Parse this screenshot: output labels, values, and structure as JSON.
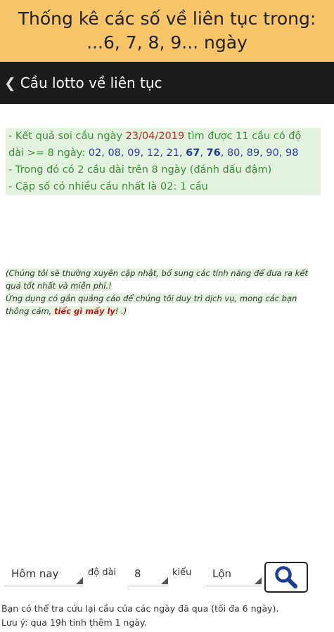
{
  "banner": {
    "line1": "Thống kê các số về liên tục trong:",
    "line2": "...6, 7, 8, 9... ngày"
  },
  "appbar": {
    "title": "Cầu lotto về liên tục"
  },
  "result": {
    "prefix": "- Kết quả soi cầu ngày ",
    "date": "23/04/2019",
    "middle": " tìm được 11 cầu có độ dài >= 8 ngày: ",
    "numbers": [
      {
        "value": "02",
        "bold": false
      },
      {
        "value": "08",
        "bold": false
      },
      {
        "value": "09",
        "bold": false
      },
      {
        "value": "12",
        "bold": false
      },
      {
        "value": "21",
        "bold": false
      },
      {
        "value": "67",
        "bold": true
      },
      {
        "value": "76",
        "bold": true
      },
      {
        "value": "80",
        "bold": false
      },
      {
        "value": "89",
        "bold": false
      },
      {
        "value": "90",
        "bold": false
      },
      {
        "value": "98",
        "bold": false
      }
    ],
    "line2": "- Trong đó có 2 cầu dài trên 8 ngày (đánh dấu đậm)",
    "line3": "- Cặp số có nhiều cầu nhất là 02: 1 cầu"
  },
  "note": {
    "part1": "(Chúng tôi sẽ thường xuyên cập nhật, bổ sung các tính năng để đưa ra kết quả tốt nhất và miễn phí.!",
    "part2": "Ứng dụng có gắn quảng cáo để chúng tôi duy trì dịch vụ, mong các bạn thông cảm, ",
    "red": "tiếc gì mấy ly",
    "part3": "! .)"
  },
  "controls": {
    "day_select": "Hôm nay",
    "length_label": "độ dài",
    "length_select": "8",
    "type_label": "kiểu",
    "type_select": "Lộn",
    "search_icon": "search-icon"
  },
  "hint": {
    "line1": "Bạn có thể tra cứu lại cầu của các ngày đã qua (tối đa 6 ngày).",
    "line2": "Lưu ý: qua 19h tính thêm 1 ngày."
  },
  "colors": {
    "banner_bg": "#f9c56a",
    "appbar_bg": "#1c1c1c",
    "result_bg": "#e4f3df",
    "result_text": "#3d8c3a",
    "date_red": "#c02b2b",
    "number_blue": "#2a3ea8"
  }
}
